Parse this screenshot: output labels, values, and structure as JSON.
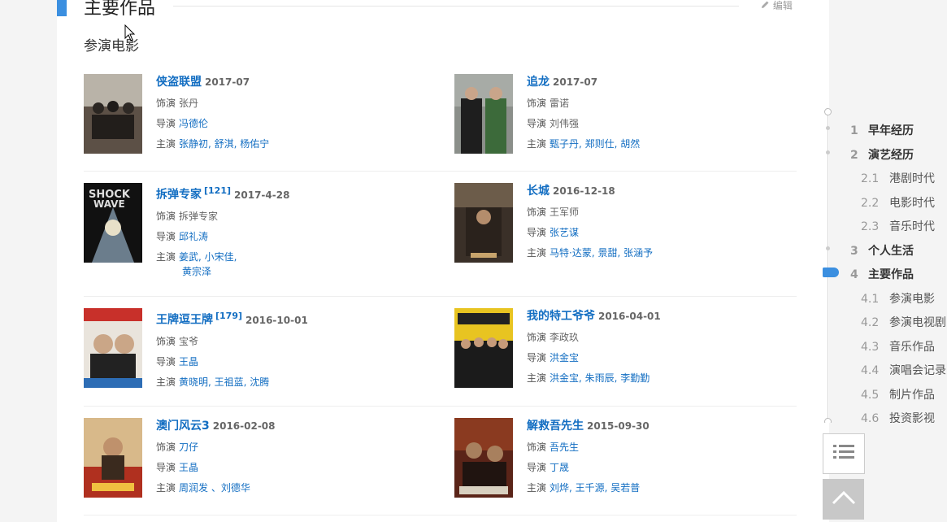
{
  "section": {
    "title": "主要作品",
    "edit_label": "编辑"
  },
  "subsection": {
    "title": "参演电影"
  },
  "films": [
    {
      "name": "侠盗联盟",
      "ref": "",
      "date": "2017-07",
      "role_label": "饰演",
      "role": "张丹",
      "director_label": "导演",
      "director": "冯德伦",
      "cast_label": "主演",
      "cast": "张静初, 舒淇, 杨佑宁",
      "cast2": ""
    },
    {
      "name": "追龙",
      "ref": "",
      "date": "2017-07",
      "role_label": "饰演",
      "role": "雷诺",
      "director_label": "导演",
      "director": "刘伟强",
      "cast_label": "主演",
      "cast": "甄子丹, 郑则仕, 胡然",
      "cast2": ""
    },
    {
      "name": "拆弹专家",
      "ref": "[121]",
      "date": "2017-4-28",
      "role_label": "饰演",
      "role": "拆弹专家",
      "director_label": "导演",
      "director": "邱礼涛",
      "cast_label": "主演",
      "cast": "姜武, 小宋佳,",
      "cast2": "黄宗泽"
    },
    {
      "name": "长城",
      "ref": "",
      "date": "2016-12-18",
      "role_label": "饰演",
      "role": "王军师",
      "director_label": "导演",
      "director": "张艺谋",
      "cast_label": "主演",
      "cast": "马特·达蒙, 景甜, 张涵予",
      "cast2": ""
    },
    {
      "name": "王牌逗王牌",
      "ref": "[179]",
      "date": "2016-10-01",
      "role_label": "饰演",
      "role": "宝爷",
      "director_label": "导演",
      "director": "王晶",
      "cast_label": "主演",
      "cast": "黄晓明, 王祖蓝, 沈腾",
      "cast2": ""
    },
    {
      "name": "我的特工爷爷",
      "ref": "",
      "date": "2016-04-01",
      "role_label": "饰演",
      "role": "李政玖",
      "director_label": "导演",
      "director": "洪金宝",
      "cast_label": "主演",
      "cast": "洪金宝, 朱雨辰, 李勤勤",
      "cast2": ""
    },
    {
      "name": "澳门风云3",
      "ref": "",
      "date": "2016-02-08",
      "role_label": "饰演",
      "role": "刀仔",
      "director_label": "导演",
      "director": "王晶",
      "cast_label": "主演",
      "cast": "周润发 、刘德华",
      "cast2": ""
    },
    {
      "name": "解救吾先生",
      "ref": "",
      "date": "2015-09-30",
      "role_label": "饰演",
      "role": "吾先生",
      "director_label": "导演",
      "director": "丁晟",
      "cast_label": "主演",
      "cast": "刘烨, 王千源, 吴若普",
      "cast2": ""
    }
  ],
  "nav": {
    "items": [
      {
        "num": "1",
        "label": "早年经历",
        "level": 1
      },
      {
        "num": "2",
        "label": "演艺经历",
        "level": 1
      },
      {
        "num": "2.1",
        "label": "港剧时代",
        "level": 2
      },
      {
        "num": "2.2",
        "label": "电影时代",
        "level": 2
      },
      {
        "num": "2.3",
        "label": "音乐时代",
        "level": 2
      },
      {
        "num": "3",
        "label": "个人生活",
        "level": 1
      },
      {
        "num": "4",
        "label": "主要作品",
        "level": 1,
        "active": true
      },
      {
        "num": "4.1",
        "label": "参演电影",
        "level": 2
      },
      {
        "num": "4.2",
        "label": "参演电视剧",
        "level": 2
      },
      {
        "num": "4.3",
        "label": "音乐作品",
        "level": 2
      },
      {
        "num": "4.4",
        "label": "演唱会记录",
        "level": 2
      },
      {
        "num": "4.5",
        "label": "制片作品",
        "level": 2
      },
      {
        "num": "4.6",
        "label": "投资影视",
        "level": 2
      }
    ]
  },
  "colors": {
    "accent": "#3b8fe0",
    "link": "#136ec2"
  },
  "icons": {
    "edit": "pencil-icon",
    "menu": "list-icon",
    "top": "chevron-up-icon"
  }
}
